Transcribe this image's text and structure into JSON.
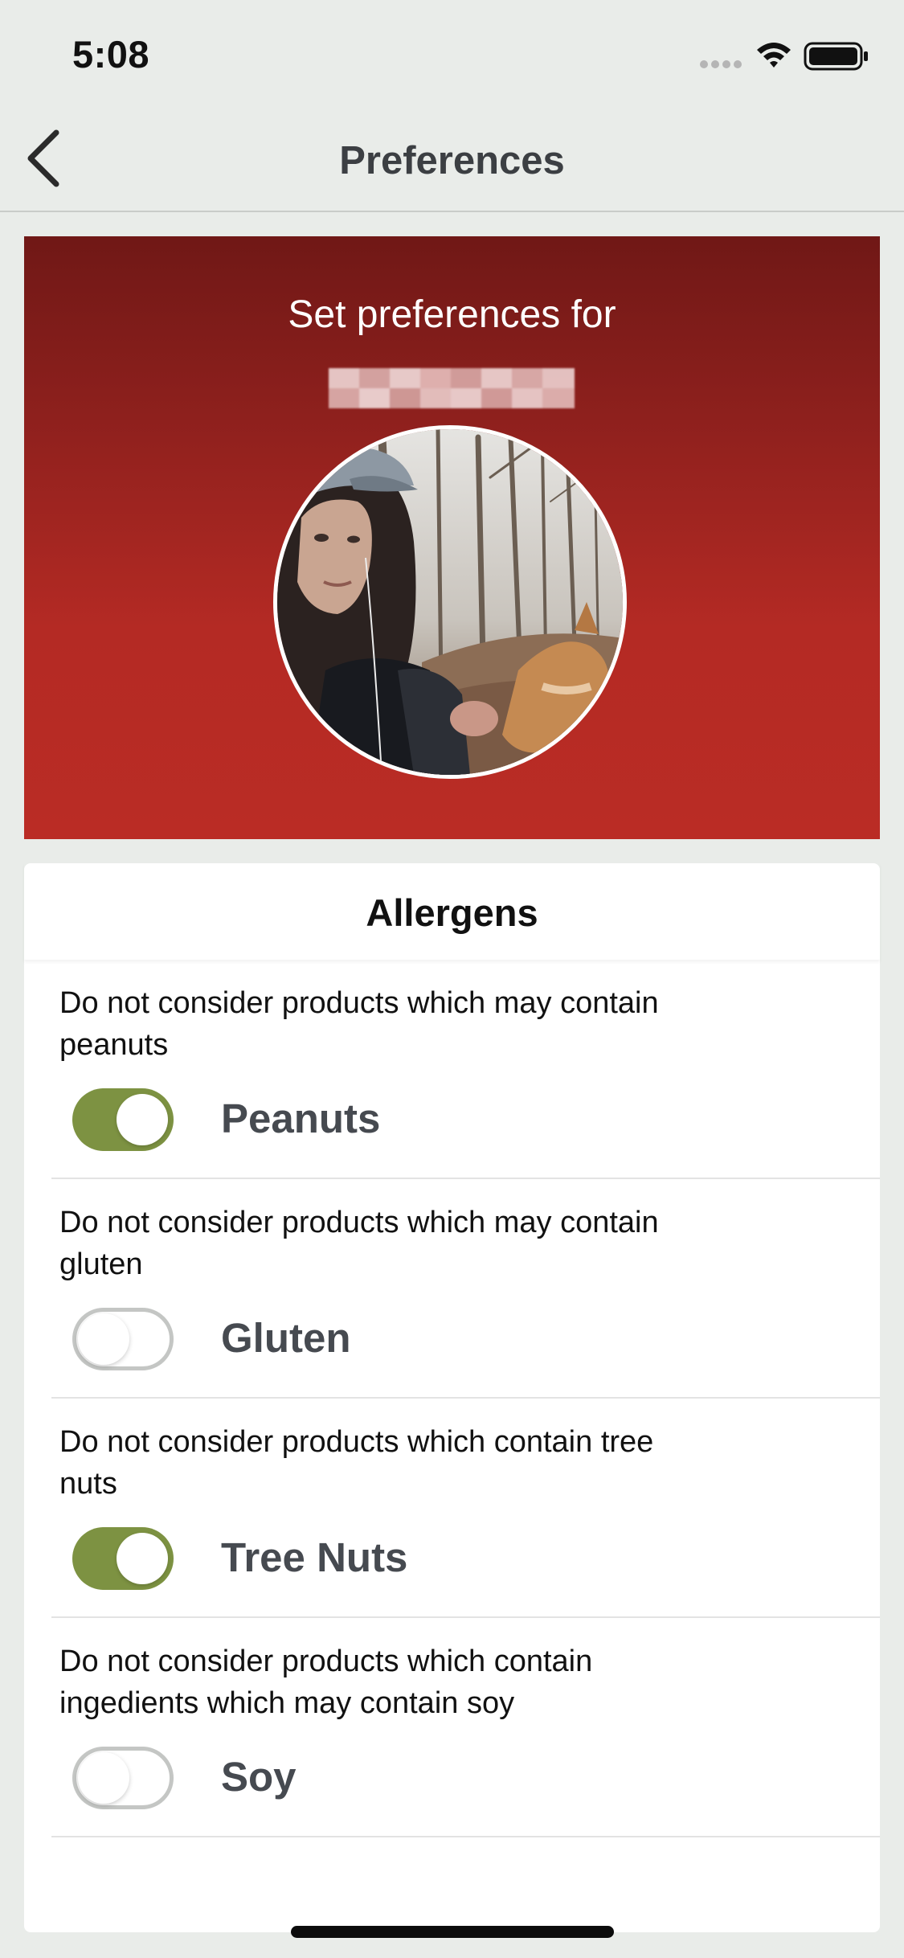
{
  "status_bar": {
    "time": "5:08"
  },
  "nav": {
    "title": "Preferences",
    "back_icon": "chevron-left-icon"
  },
  "banner": {
    "title": "Set preferences for",
    "name_redacted": true
  },
  "allergens": {
    "title": "Allergens",
    "items": [
      {
        "description": "Do not consider products which may contain peanuts",
        "label": "Peanuts",
        "enabled": true
      },
      {
        "description": "Do not consider products which may contain gluten",
        "label": "Gluten",
        "enabled": false
      },
      {
        "description": "Do not consider products which contain tree nuts",
        "label": "Tree Nuts",
        "enabled": true
      },
      {
        "description": "Do not consider products which contain ingedients which may contain soy",
        "label": "Soy",
        "enabled": false
      }
    ]
  },
  "colors": {
    "toggle_on": "#7d9242",
    "toggle_off_border": "#c4c6c4",
    "banner_top": "#701816",
    "banner_bottom": "#ba2c25",
    "background": "#e9ece9"
  }
}
